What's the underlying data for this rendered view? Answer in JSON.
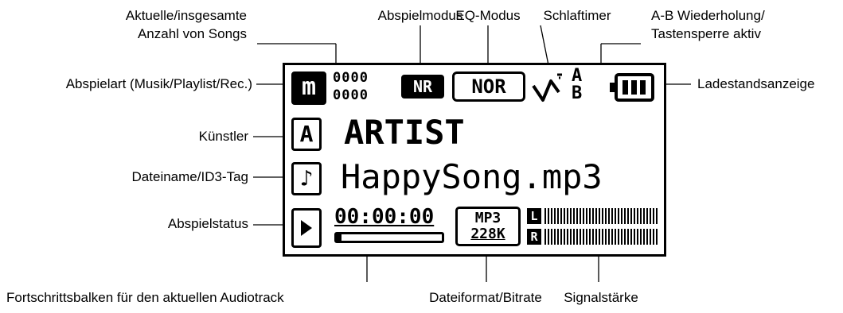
{
  "labels": {
    "song_count_line1": "Aktuelle/insgesamte",
    "song_count_line2": "Anzahl von Songs",
    "play_mode": "Abspielmodus",
    "eq_mode": "EQ-Modus",
    "sleep_timer": "Schlaftimer",
    "ab_repeat_line1": "A-B Wiederholung/",
    "ab_repeat_line2": "Tastensperre aktiv",
    "play_type": "Abspielart (Musik/Playlist/Rec.)",
    "battery": "Ladestandsanzeige",
    "artist": "Künstler",
    "filename": "Dateiname/ID3-Tag",
    "play_status": "Abspielstatus",
    "progress": "Fortschrittsbalken für den aktuellen Audiotrack",
    "format_bitrate": "Dateiformat/Bitrate",
    "signal": "Signalstärke"
  },
  "display": {
    "music_icon": "m",
    "song_current": "0000",
    "song_total": "0000",
    "mode_badge": "NR",
    "eq_value": "NOR",
    "ab_a": "A",
    "ab_b": "B",
    "artist_badge": "A",
    "artist_name": "ARTIST",
    "note_icon": "♪",
    "file_name": "HappySong.mp3",
    "time": "00:00:00",
    "format": "MP3",
    "bitrate": "228K",
    "channel_l": "L",
    "channel_r": "R"
  },
  "progress": {
    "fraction": 0.0
  }
}
